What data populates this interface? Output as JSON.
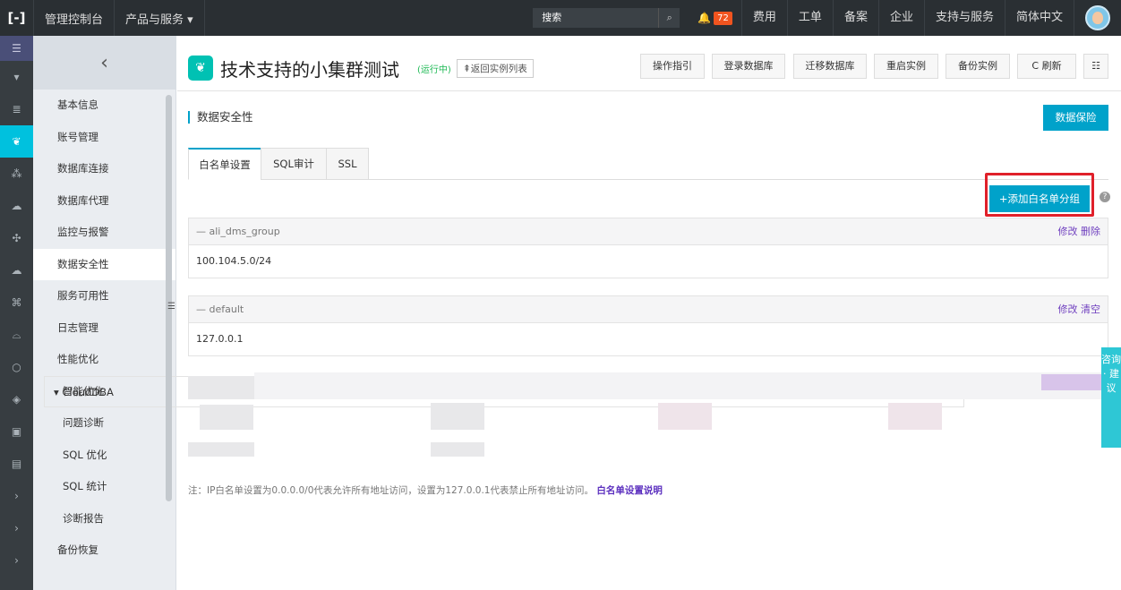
{
  "topbar": {
    "logo": "[-]",
    "console": "管理控制台",
    "products": "产品与服务 ▾",
    "search_placeholder": "搜索",
    "notifications": "72",
    "items": [
      "费用",
      "工单",
      "备案",
      "企业",
      "支持与服务",
      "简体中文"
    ]
  },
  "sidebar": {
    "back": "‹",
    "items": [
      "基本信息",
      "账号管理",
      "数据库连接",
      "数据库代理",
      "监控与报警",
      "数据安全性",
      "服务可用性",
      "日志管理",
      "性能优化"
    ],
    "group": "▾  CloudDBA",
    "sub_items": [
      "智能优化",
      "问题诊断",
      "SQL 优化",
      "SQL 统计",
      "诊断报告"
    ],
    "last_item": "备份恢复"
  },
  "header": {
    "title": "技术支持的小集群测试",
    "status": "(运行中)",
    "back_link": "⇞返回实例列表",
    "buttons": [
      "操作指引",
      "登录数据库",
      "迁移数据库",
      "重启实例",
      "备份实例",
      "C 刷新"
    ]
  },
  "section": {
    "title": "数据安全性",
    "protect_button": "数据保险"
  },
  "tabs": [
    "白名单设置",
    "SQL审计",
    "SSL"
  ],
  "add_group_button": "+添加白名单分组",
  "groups": [
    {
      "name": "— ali_dms_group",
      "actions": "修改 删除",
      "ips": "100.104.5.0/24"
    },
    {
      "name": "— default",
      "actions": "修改 清空",
      "ips": "127.0.0.1"
    }
  ],
  "note": {
    "text": "注：IP白名单设置为0.0.0.0/0代表允许所有地址访问，设置为127.0.0.1代表禁止所有地址访问。",
    "link": "白名单设置说明"
  },
  "float_tab": "咨询 · 建议"
}
